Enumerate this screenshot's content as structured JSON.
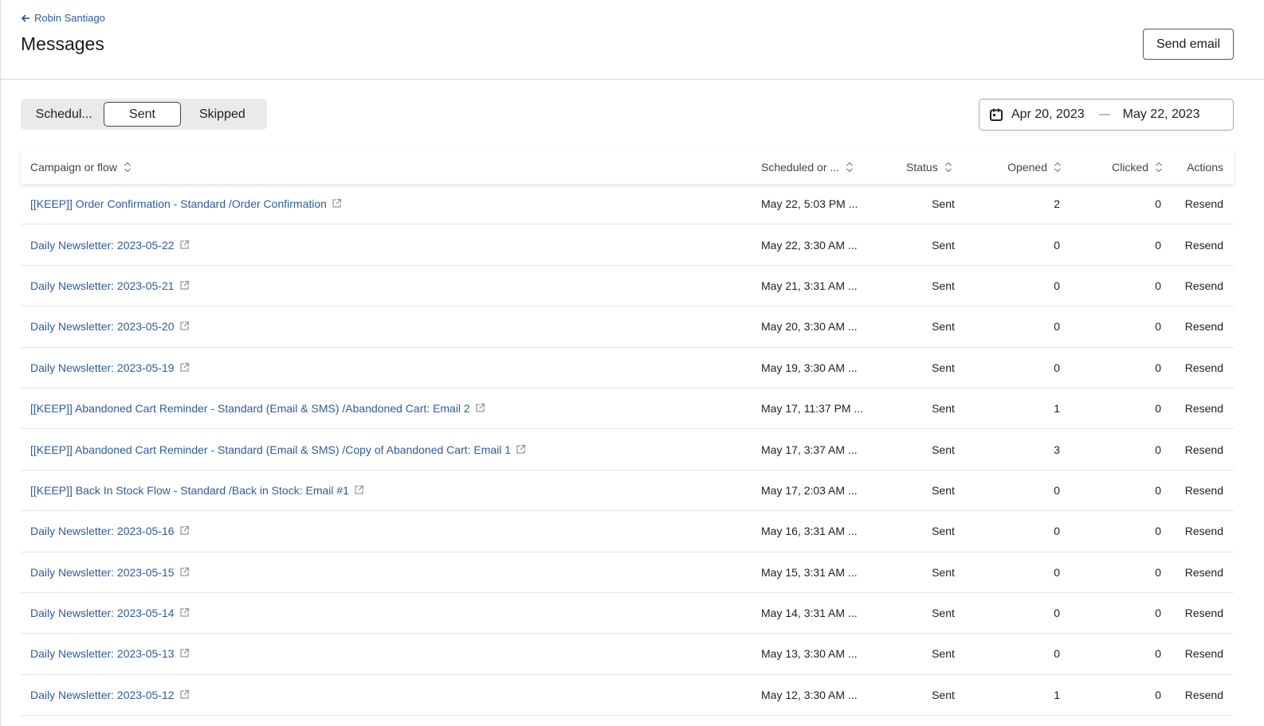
{
  "header": {
    "back_label": "Robin Santiago",
    "title": "Messages",
    "send_email": "Send email"
  },
  "tabs": [
    {
      "label": "Schedul..."
    },
    {
      "label": "Sent",
      "active": true
    },
    {
      "label": "Skipped"
    }
  ],
  "date_range": {
    "start": "Apr 20, 2023",
    "end": "May 22, 2023"
  },
  "columns": [
    "Campaign or flow",
    "Scheduled or ...",
    "Status",
    "Opened",
    "Clicked",
    "Actions"
  ],
  "rows": [
    {
      "name": "[[KEEP]] Order Confirmation - Standard /Order Confirmation",
      "date": "May 22, 5:03 PM ...",
      "status": "Sent",
      "opened": "2",
      "clicked": "0",
      "action": "Resend"
    },
    {
      "name": "Daily Newsletter: 2023-05-22",
      "date": "May 22, 3:30 AM ...",
      "status": "Sent",
      "opened": "0",
      "clicked": "0",
      "action": "Resend"
    },
    {
      "name": "Daily Newsletter: 2023-05-21",
      "date": "May 21, 3:31 AM ...",
      "status": "Sent",
      "opened": "0",
      "clicked": "0",
      "action": "Resend"
    },
    {
      "name": "Daily Newsletter: 2023-05-20",
      "date": "May 20, 3:30 AM ...",
      "status": "Sent",
      "opened": "0",
      "clicked": "0",
      "action": "Resend"
    },
    {
      "name": "Daily Newsletter: 2023-05-19",
      "date": "May 19, 3:30 AM ...",
      "status": "Sent",
      "opened": "0",
      "clicked": "0",
      "action": "Resend"
    },
    {
      "name": "[[KEEP]] Abandoned Cart Reminder - Standard (Email & SMS) /Abandoned Cart: Email 2",
      "date": "May 17, 11:37 PM ...",
      "status": "Sent",
      "opened": "1",
      "clicked": "0",
      "action": "Resend"
    },
    {
      "name": "[[KEEP]] Abandoned Cart Reminder - Standard (Email & SMS) /Copy of Abandoned Cart: Email 1",
      "date": "May 17, 3:37 AM ...",
      "status": "Sent",
      "opened": "3",
      "clicked": "0",
      "action": "Resend"
    },
    {
      "name": "[[KEEP]] Back In Stock Flow - Standard /Back in Stock: Email #1",
      "date": "May 17, 2:03 AM ...",
      "status": "Sent",
      "opened": "0",
      "clicked": "0",
      "action": "Resend"
    },
    {
      "name": "Daily Newsletter: 2023-05-16",
      "date": "May 16, 3:31 AM ...",
      "status": "Sent",
      "opened": "0",
      "clicked": "0",
      "action": "Resend"
    },
    {
      "name": "Daily Newsletter: 2023-05-15",
      "date": "May 15, 3:31 AM ...",
      "status": "Sent",
      "opened": "0",
      "clicked": "0",
      "action": "Resend"
    },
    {
      "name": "Daily Newsletter: 2023-05-14",
      "date": "May 14, 3:31 AM ...",
      "status": "Sent",
      "opened": "0",
      "clicked": "0",
      "action": "Resend"
    },
    {
      "name": "Daily Newsletter: 2023-05-13",
      "date": "May 13, 3:30 AM ...",
      "status": "Sent",
      "opened": "0",
      "clicked": "0",
      "action": "Resend"
    },
    {
      "name": "Daily Newsletter: 2023-05-12",
      "date": "May 12, 3:30 AM ...",
      "status": "Sent",
      "opened": "1",
      "clicked": "0",
      "action": "Resend"
    }
  ]
}
